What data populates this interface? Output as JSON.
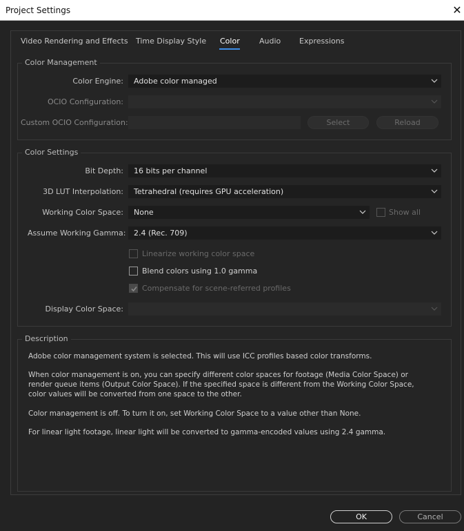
{
  "window": {
    "title": "Project Settings",
    "close_glyph": "✕"
  },
  "tabs": [
    {
      "label": "Video Rendering and Effects",
      "active": false
    },
    {
      "label": "Time Display Style",
      "active": false
    },
    {
      "label": "Color",
      "active": true
    },
    {
      "label": "Audio",
      "active": false
    },
    {
      "label": "Expressions",
      "active": false
    }
  ],
  "color_management": {
    "legend": "Color Management",
    "engine_label": "Color Engine:",
    "engine_value": "Adobe color managed",
    "ocio_label": "OCIO Configuration:",
    "ocio_value": "",
    "custom_ocio_label": "Custom OCIO Configuration:",
    "select_label": "Select",
    "reload_label": "Reload"
  },
  "color_settings": {
    "legend": "Color Settings",
    "bit_depth_label": "Bit Depth:",
    "bit_depth_value": "16 bits per channel",
    "lut_label": "3D LUT Interpolation:",
    "lut_value": "Tetrahedral (requires GPU acceleration)",
    "working_space_label": "Working Color Space:",
    "working_space_value": "None",
    "show_all_label": "Show all",
    "gamma_label": "Assume Working Gamma:",
    "gamma_value": "2.4 (Rec. 709)",
    "linearize_label": "Linearize working color space",
    "blend_label": "Blend colors using 1.0 gamma",
    "compensate_label": "Compensate for scene-referred profiles",
    "display_space_label": "Display Color Space:",
    "display_space_value": ""
  },
  "description": {
    "legend": "Description",
    "p1": "Adobe color management system is selected. This will use ICC profiles based color transforms.",
    "p2_l1": "When color management is on, you can specify different color spaces for footage (Media Color Space) or",
    "p2_l2": "render queue items (Output Color Space). If the specified space is different from the Working Color Space,",
    "p2_l3": "color values will be converted from one space to the other.",
    "p3": "Color management is off. To turn it on, set Working Color Space to a value other than None.",
    "p4": "For linear light footage, linear light will be converted to gamma-encoded values using 2.4 gamma."
  },
  "footer": {
    "ok_label": "OK",
    "cancel_label": "Cancel"
  },
  "colors": {
    "accent": "#3d8ee8",
    "background": "#232323",
    "panel": "#252525",
    "field": "#1c1c1c"
  }
}
